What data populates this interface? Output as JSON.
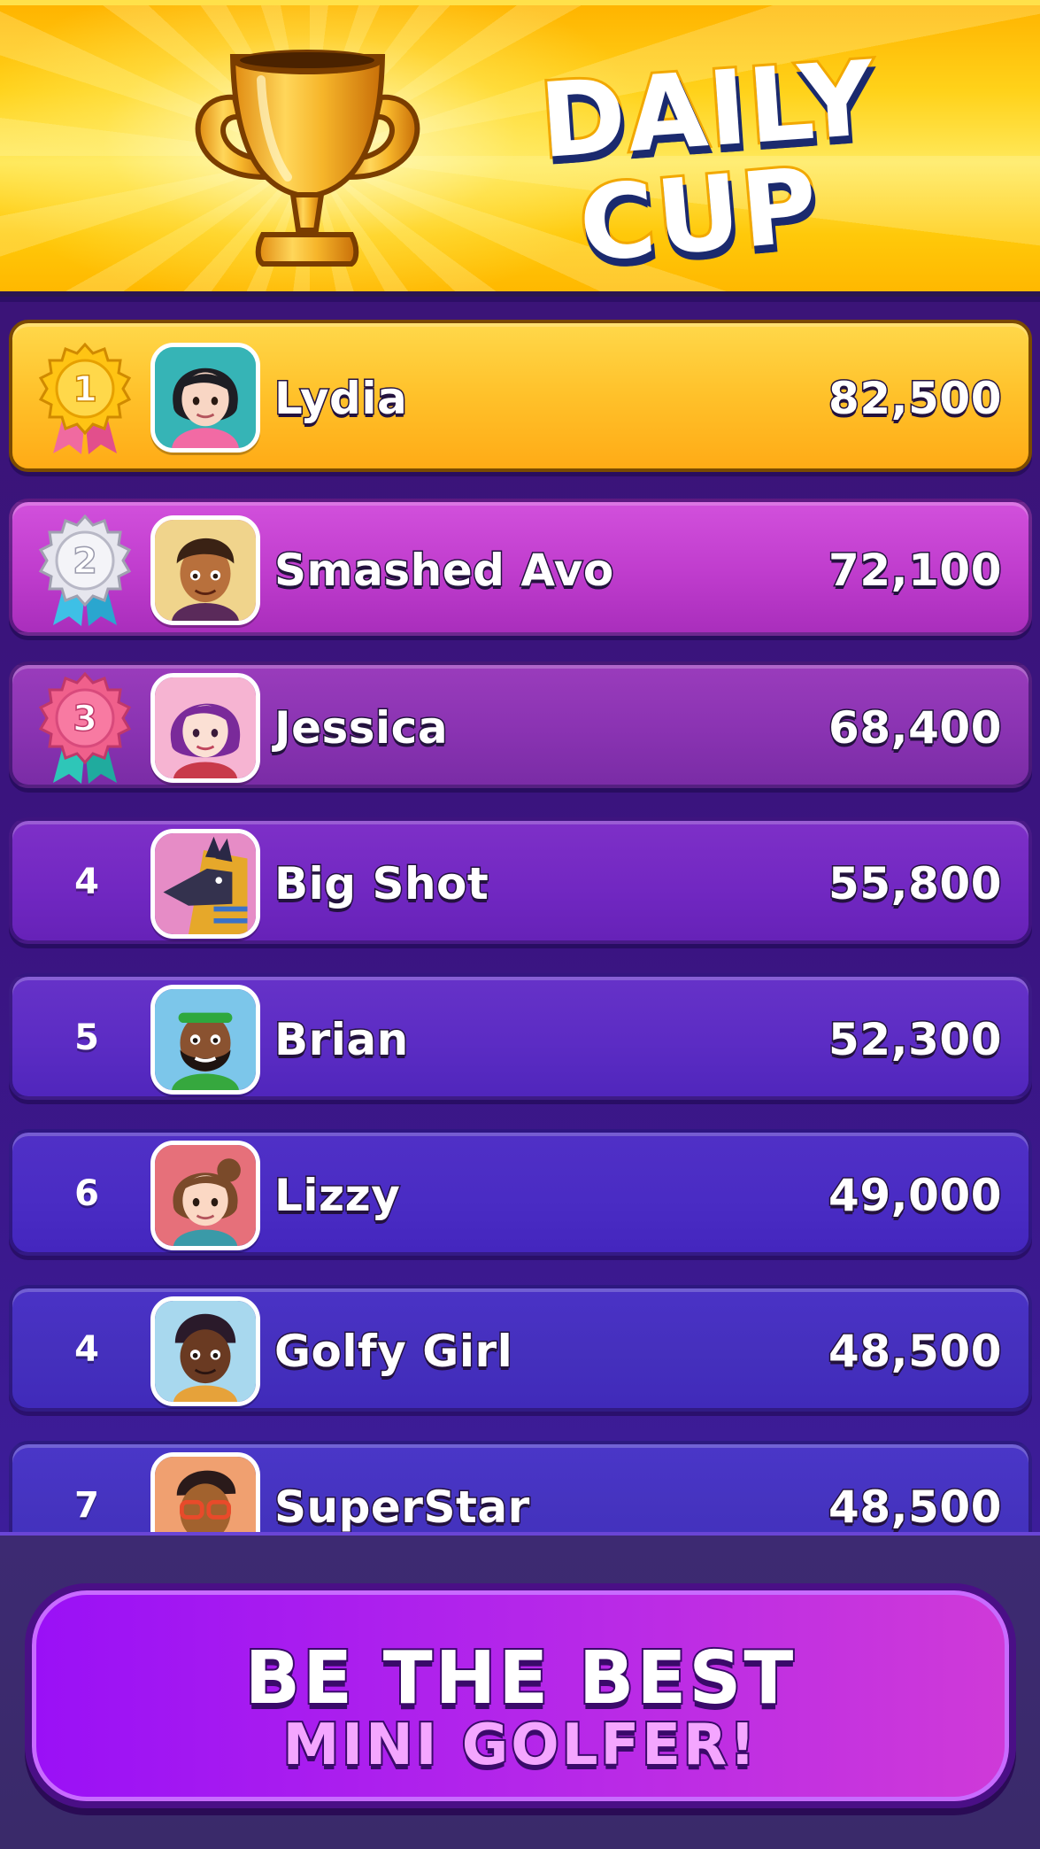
{
  "header": {
    "title_line1": "DAILY",
    "title_line2": "CUP",
    "trophy_icon": "trophy-icon"
  },
  "leaderboard": {
    "rows": [
      {
        "rank": "1",
        "name": "Lydia",
        "score": "82,500",
        "medal": "gold-medal-icon",
        "row_color": "#ffbb22"
      },
      {
        "rank": "2",
        "name": "Smashed Avo",
        "score": "72,100",
        "medal": "silver-medal-icon",
        "row_color": "#c13ed0"
      },
      {
        "rank": "3",
        "name": "Jessica",
        "score": "68,400",
        "medal": "bronze-medal-icon",
        "row_color": "#8d35b4"
      },
      {
        "rank": "4",
        "name": "Big Shot",
        "score": "55,800",
        "row_color": "#7428c4"
      },
      {
        "rank": "5",
        "name": "Brian",
        "score": "52,300",
        "row_color": "#5d2cc4"
      },
      {
        "rank": "6",
        "name": "Lizzy",
        "score": "49,000",
        "row_color": "#4a2dc4"
      },
      {
        "rank": "4",
        "name": "Golfy Girl",
        "score": "48,500",
        "row_color": "#4530bd"
      },
      {
        "rank": "7",
        "name": "SuperStar",
        "score": "48,500",
        "row_color": "#4533bf"
      }
    ]
  },
  "footer": {
    "cta_line1": "BE THE BEST",
    "cta_line2": "MINI GOLFER!"
  }
}
